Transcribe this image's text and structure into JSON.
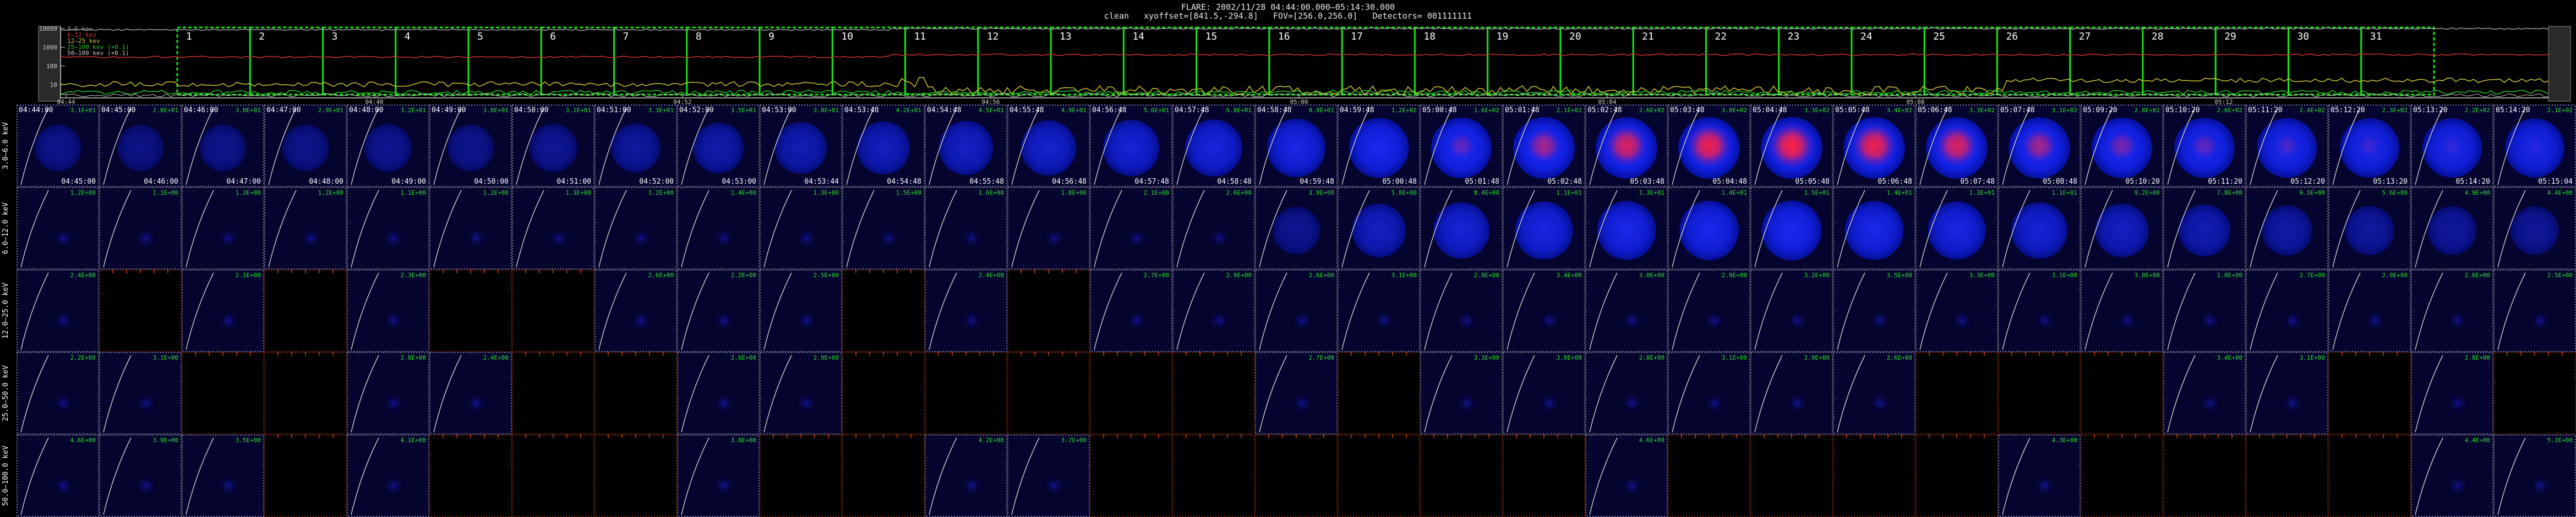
{
  "header": {
    "line1": "FLARE: 2002/11/28 04:44:00.000—05:14:30.000",
    "line2": "clean   xyoffset=[841.5,-294.8]   FOV=[256.0,256.0]   Detectors= 001111111"
  },
  "lightcurve": {
    "legend": [
      "3–6 kev",
      "6–12 kev",
      "12–25 kev",
      "25–100 kev (×0.1)",
      "50–100 kev (×0.1)"
    ],
    "legend_colors": [
      "#a0a0a0",
      "#d23232",
      "#d2c832",
      "#28c828",
      "#c8c8c8"
    ],
    "y_ticks": [
      "10000",
      "1000",
      "100",
      "10"
    ],
    "x_ticks": [
      "04:44",
      "04:48",
      "04:52",
      "04:56",
      "05:00",
      "05:04",
      "05:08",
      "05:12"
    ],
    "interval_numbers": [
      "1",
      "2",
      "3",
      "4",
      "5",
      "6",
      "7",
      "8",
      "9",
      "10",
      "11",
      "12",
      "13",
      "14",
      "15",
      "16",
      "17",
      "18",
      "19",
      "20",
      "21",
      "22",
      "23",
      "24",
      "25",
      "26",
      "27",
      "28",
      "29",
      "30",
      "31"
    ],
    "box_color": "#14e614"
  },
  "energy_bands": [
    "3.0–6.0 keV",
    "6.0–12.0 keV",
    "12.0–25.0 keV",
    "25.0–50.0 keV",
    "50.0–100.0 keV"
  ],
  "start_times": [
    "04:44:00",
    "04:45:00",
    "04:46:00",
    "04:47:00",
    "04:48:00",
    "04:49:00",
    "04:50:00",
    "04:51:00",
    "04:52:00",
    "04:53:00",
    "04:53:48",
    "04:54:48",
    "04:55:48",
    "04:56:48",
    "04:57:48",
    "04:58:48",
    "04:59:48",
    "05:00:48",
    "05:01:48",
    "05:02:48",
    "05:03:48",
    "05:04:48",
    "05:05:48",
    "05:06:48",
    "05:07:48",
    "05:09:20",
    "05:10:20",
    "05:11:20",
    "05:12:20",
    "05:13:20",
    "05:14:20"
  ],
  "end_times": [
    "04:45:00",
    "04:46:00",
    "04:47:00",
    "04:48:00",
    "04:49:00",
    "04:50:00",
    "04:51:00",
    "04:52:00",
    "04:53:00",
    "04:53:44",
    "04:54:48",
    "04:55:48",
    "04:56:48",
    "04:57:48",
    "04:58:48",
    "04:59:48",
    "05:00:48",
    "05:01:48",
    "05:02:48",
    "05:03:48",
    "05:04:48",
    "05:05:48",
    "05:06:48",
    "05:07:48",
    "05:08:48",
    "05:10:20",
    "05:11:20",
    "05:12:20",
    "05:13:20",
    "05:14:20",
    "05:15:04"
  ],
  "peak_labels": [
    [
      "3.1E+01",
      "2.8E+01",
      "3.0E+01",
      "2.9E+01",
      "3.2E+01",
      "3.0E+01",
      "3.1E+01",
      "3.3E+01",
      "3.5E+01",
      "3.8E+01",
      "4.2E+01",
      "4.5E+01",
      "4.9E+01",
      "5.6E+01",
      "6.8E+01",
      "8.9E+01",
      "1.2E+02",
      "1.6E+02",
      "2.1E+02",
      "2.6E+02",
      "3.0E+02",
      "3.3E+02",
      "3.4E+02",
      "3.3E+02",
      "3.1E+02",
      "2.8E+02",
      "2.6E+02",
      "2.4E+02",
      "2.3E+02",
      "2.2E+02",
      "2.1E+02"
    ],
    [
      "1.2E+00",
      "1.1E+00",
      "1.3E+00",
      "1.2E+00",
      "1.1E+00",
      "1.2E+00",
      "1.3E+00",
      "1.2E+00",
      "1.4E+00",
      "1.3E+00",
      "1.5E+00",
      "1.6E+00",
      "1.8E+00",
      "2.1E+00",
      "2.6E+00",
      "3.9E+00",
      "5.8E+00",
      "8.4E+00",
      "1.1E+01",
      "1.3E+01",
      "1.4E+01",
      "1.5E+01",
      "1.4E+01",
      "1.3E+01",
      "1.1E+01",
      "9.2E+00",
      "7.8E+00",
      "6.5E+00",
      "5.6E+00",
      "4.9E+00",
      "4.4E+00"
    ],
    [
      "2.4E+00",
      "",
      "2.1E+00",
      "",
      "2.3E+00",
      "",
      "",
      "2.6E+00",
      "2.2E+00",
      "2.5E+00",
      "",
      "2.4E+00",
      "",
      "2.7E+00",
      "2.9E+00",
      "2.6E+00",
      "3.1E+00",
      "2.8E+00",
      "3.4E+00",
      "3.0E+00",
      "2.9E+00",
      "3.2E+00",
      "3.5E+00",
      "3.3E+00",
      "3.1E+00",
      "3.0E+00",
      "2.8E+00",
      "2.7E+00",
      "2.9E+00",
      "2.6E+00",
      "2.5E+00"
    ],
    [
      "2.2E+00",
      "3.1E+00",
      "",
      "",
      "2.8E+00",
      "2.4E+00",
      "",
      "",
      "2.6E+00",
      "2.9E+00",
      "",
      "",
      "",
      "",
      "",
      "2.7E+00",
      "",
      "3.3E+00",
      "3.0E+00",
      "2.8E+00",
      "3.1E+00",
      "2.9E+00",
      "2.6E+00",
      "",
      "",
      "",
      "3.4E+00",
      "3.1E+00",
      "",
      "2.8E+00",
      ""
    ],
    [
      "4.6E+00",
      "3.9E+00",
      "3.5E+00",
      "",
      "4.1E+00",
      "",
      "",
      "",
      "3.8E+00",
      "",
      "",
      "4.2E+00",
      "3.7E+00",
      "",
      "",
      "",
      "",
      "",
      "",
      "4.6E+00",
      "",
      "",
      "",
      "",
      "4.3E+00",
      "",
      "",
      "",
      "",
      "4.4E+00",
      "5.1E+00"
    ]
  ],
  "band_has_image": [
    [
      1,
      1,
      1,
      1,
      1,
      1,
      1,
      1,
      1,
      1,
      1,
      1,
      1,
      1,
      1,
      1,
      1,
      1,
      1,
      1,
      1,
      1,
      1,
      1,
      1,
      1,
      1,
      1,
      1,
      1,
      1
    ],
    [
      1,
      1,
      1,
      1,
      1,
      1,
      1,
      1,
      1,
      1,
      1,
      1,
      1,
      1,
      1,
      1,
      1,
      1,
      1,
      1,
      1,
      1,
      1,
      1,
      1,
      1,
      1,
      1,
      1,
      1,
      1
    ],
    [
      1,
      0,
      1,
      0,
      1,
      0,
      0,
      1,
      1,
      1,
      0,
      1,
      0,
      1,
      1,
      1,
      1,
      1,
      1,
      1,
      1,
      1,
      1,
      1,
      1,
      1,
      1,
      1,
      1,
      1,
      1
    ],
    [
      1,
      1,
      0,
      0,
      1,
      1,
      0,
      0,
      1,
      1,
      0,
      0,
      0,
      0,
      0,
      1,
      0,
      1,
      1,
      1,
      1,
      1,
      1,
      0,
      0,
      0,
      1,
      1,
      0,
      1,
      0
    ],
    [
      1,
      1,
      1,
      0,
      1,
      0,
      0,
      0,
      1,
      0,
      0,
      1,
      1,
      0,
      0,
      0,
      0,
      0,
      0,
      1,
      0,
      0,
      0,
      0,
      1,
      0,
      0,
      0,
      0,
      1,
      1
    ]
  ],
  "source_intensity": [
    [
      0.15,
      0.12,
      0.15,
      0.15,
      0.2,
      0.16,
      0.22,
      0.3,
      0.38,
      0.45,
      0.52,
      0.58,
      0.64,
      0.7,
      0.75,
      0.82,
      0.9,
      0.95,
      1.0,
      1.0,
      1.0,
      1.0,
      1.0,
      1.0,
      0.98,
      0.95,
      0.92,
      0.9,
      0.88,
      0.87,
      0.86
    ],
    [
      0.05,
      0.05,
      0.05,
      0.05,
      0.05,
      0.05,
      0.05,
      0.05,
      0.05,
      0.05,
      0.05,
      0.05,
      0.05,
      0.05,
      0.06,
      0.2,
      0.55,
      0.7,
      0.8,
      0.85,
      0.88,
      0.9,
      0.85,
      0.8,
      0.7,
      0.55,
      0.45,
      0.35,
      0.3,
      0.28,
      0.25
    ],
    [
      0.03,
      0,
      0.03,
      0,
      0.03,
      0,
      0,
      0.03,
      0.03,
      0.03,
      0,
      0.03,
      0,
      0.03,
      0.03,
      0.03,
      0.03,
      0.03,
      0.03,
      0.03,
      0.03,
      0.03,
      0.03,
      0.03,
      0.03,
      0.03,
      0.03,
      0.03,
      0.03,
      0.03,
      0.03
    ],
    [
      0.02,
      0.02,
      0,
      0,
      0.02,
      0.02,
      0,
      0,
      0.02,
      0.02,
      0,
      0,
      0,
      0,
      0,
      0.02,
      0,
      0.02,
      0.02,
      0.02,
      0.02,
      0.02,
      0.02,
      0,
      0,
      0,
      0.02,
      0.02,
      0,
      0.02,
      0
    ],
    [
      0.02,
      0.02,
      0.02,
      0,
      0.02,
      0,
      0,
      0,
      0.02,
      0,
      0,
      0.02,
      0.02,
      0,
      0,
      0,
      0,
      0,
      0,
      0.02,
      0,
      0,
      0,
      0,
      0.02,
      0,
      0,
      0,
      0,
      0.02,
      0.02
    ]
  ],
  "hot_core": [
    [
      0,
      0,
      0,
      0,
      0,
      0,
      0,
      0,
      0,
      0,
      0,
      0,
      0,
      0,
      0,
      0,
      0,
      0.3,
      0.6,
      0.85,
      0.95,
      1.0,
      0.95,
      0.85,
      0.6,
      0.4,
      0.3,
      0.2,
      0.15,
      0.1,
      0.05
    ]
  ]
}
